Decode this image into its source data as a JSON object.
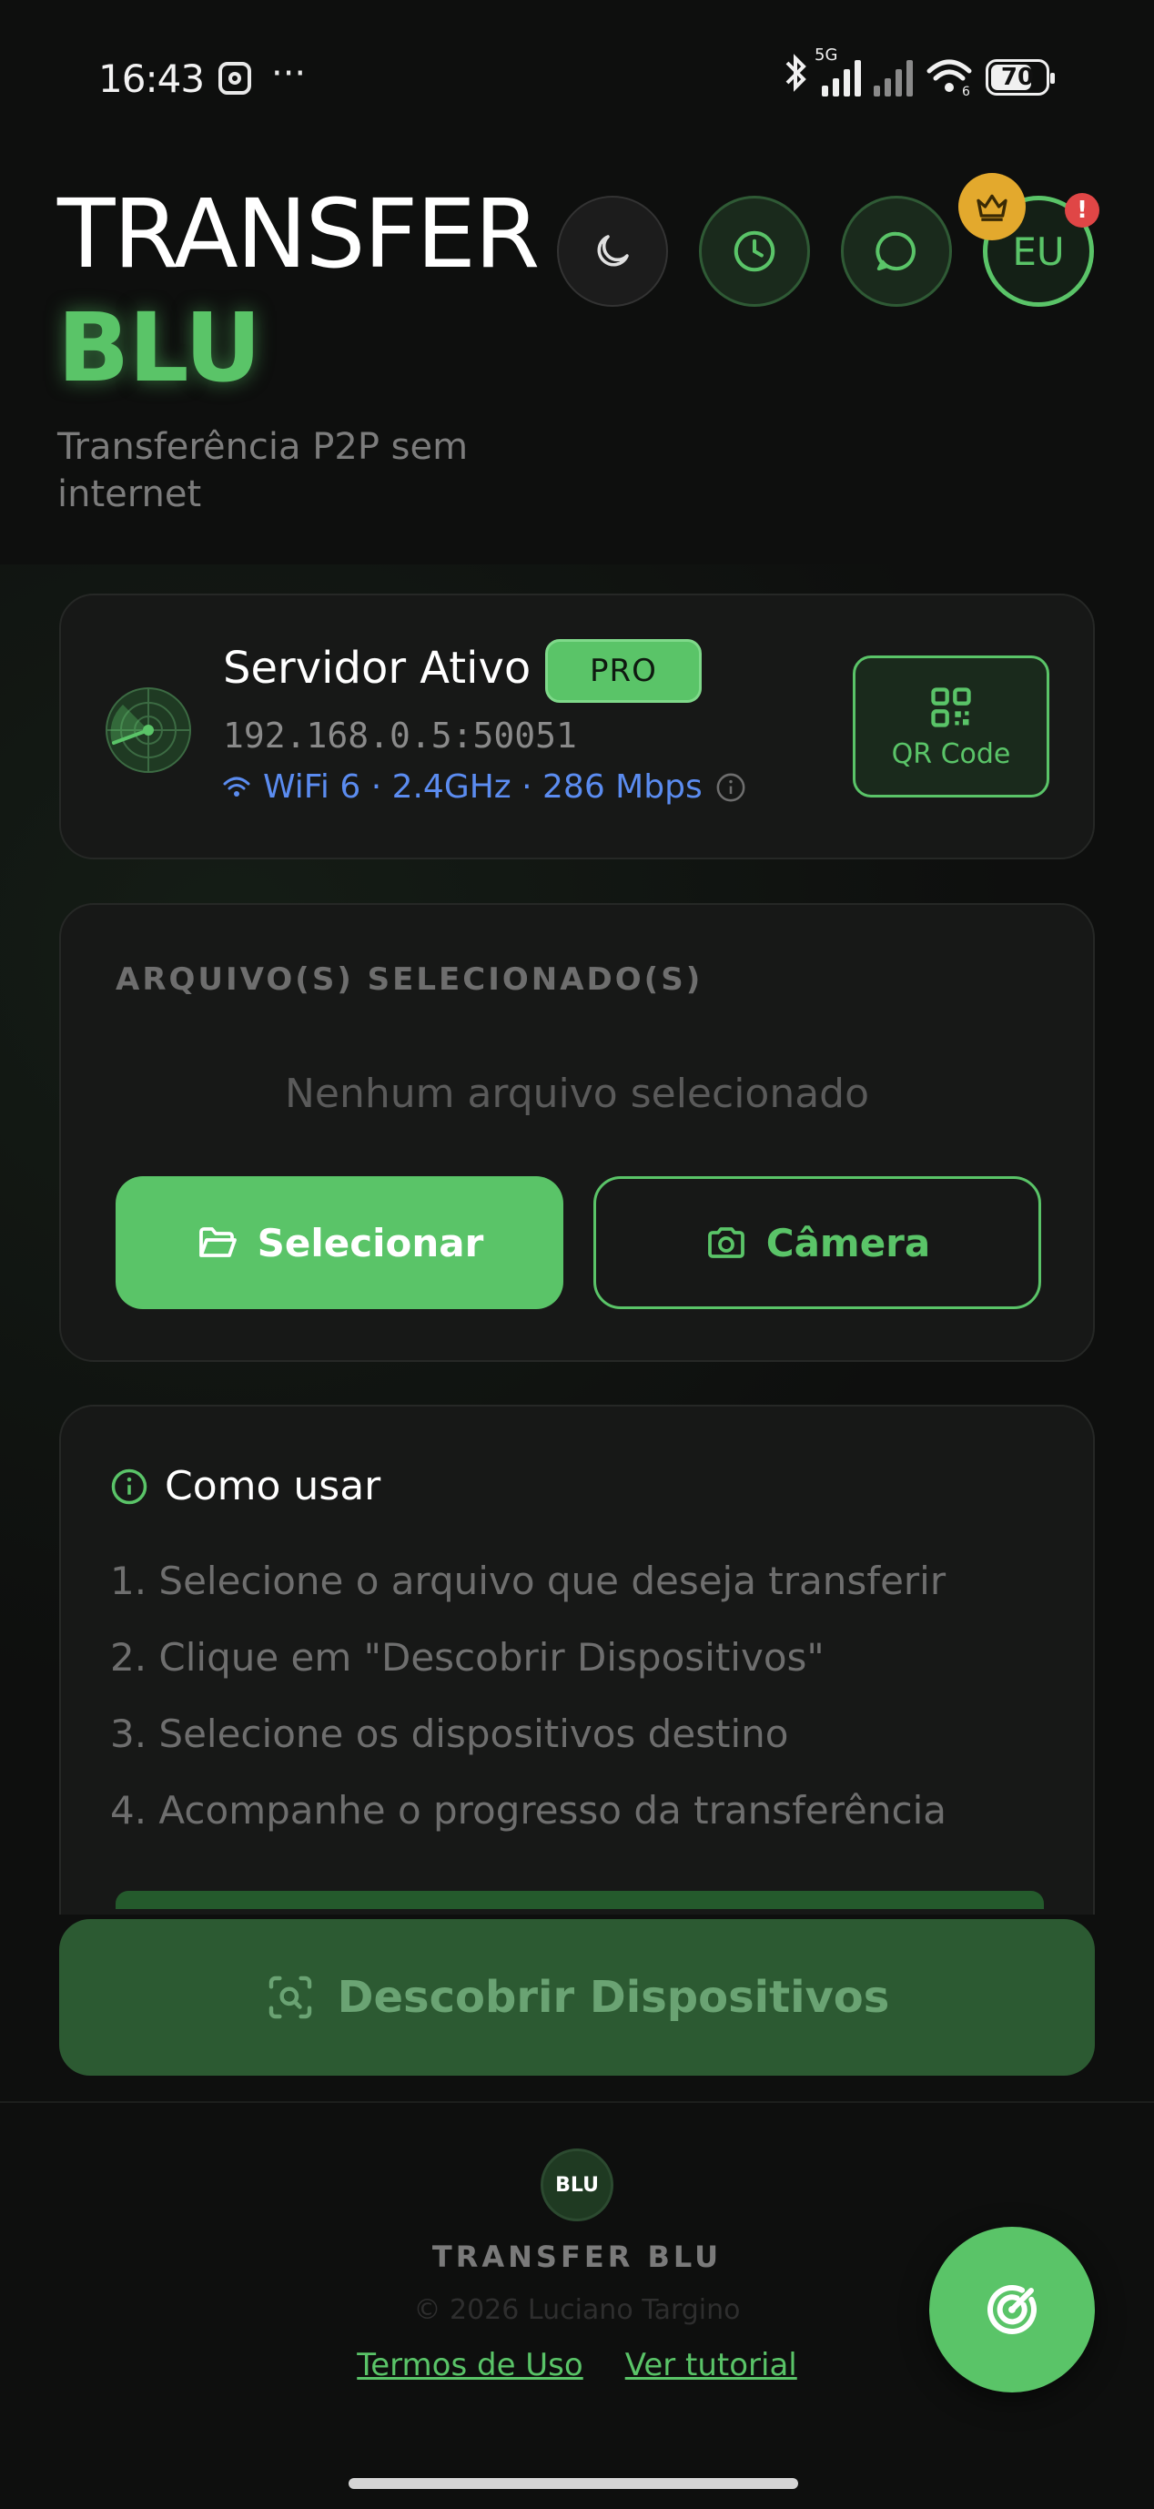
{
  "status_bar": {
    "time": "16:43",
    "network_tag": "5G",
    "wifi_tag": "6",
    "battery": "70",
    "icons": [
      "instagram-icon",
      "more-icon",
      "bluetooth-icon",
      "signal-icon",
      "wifi-icon",
      "battery-icon"
    ]
  },
  "header": {
    "title_line1": "TRANSFER",
    "title_line2": "BLU",
    "subtitle": "Transferência P2P sem internet",
    "profile_label": "EU",
    "alert_badge": "!"
  },
  "server": {
    "title": "Servidor Ativo",
    "badge": "PRO",
    "address": "192.168.0.5:50051",
    "wifi_info": "WiFi 6 · 2.4GHz · 286 Mbps",
    "qr_label": "QR Code"
  },
  "files": {
    "heading": "ARQUIVO(S) SELECIONADO(S)",
    "empty_text": "Nenhum arquivo selecionado",
    "select_label": "Selecionar",
    "camera_label": "Câmera"
  },
  "howto": {
    "title": "Como usar",
    "steps": [
      "1. Selecione o arquivo que deseja transferir",
      "2. Clique em \"Descobrir Dispositivos\"",
      "3. Selecione os dispositivos destino",
      "4. Acompanhe o progresso da transferência"
    ]
  },
  "discover": {
    "label": "Descobrir Dispositivos"
  },
  "footer": {
    "logo_text": "BLU",
    "app_name": "TRANSFER BLU",
    "copyright": "© 2026 Luciano Targino",
    "terms_label": "Termos de Uso",
    "tutorial_label": "Ver tutorial"
  },
  "colors": {
    "accent": "#5ac468",
    "background": "#0e0f0e",
    "card": "#171817",
    "link_blue": "#5b8cf0",
    "crown": "#e3a92d",
    "alert": "#e04646"
  }
}
